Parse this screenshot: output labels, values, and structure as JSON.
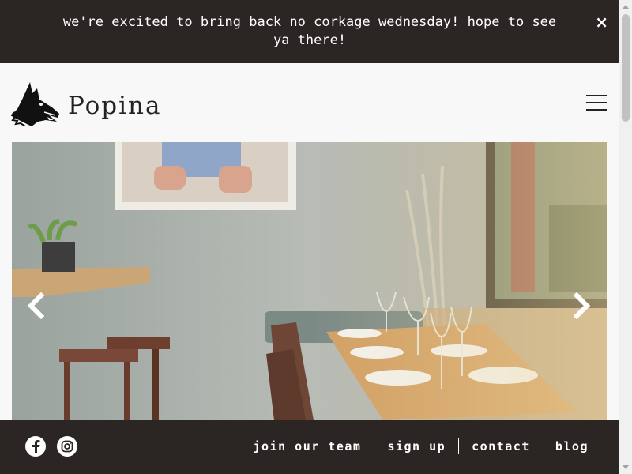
{
  "announcement": {
    "text": "we're excited to bring back no corkage wednesday! hope to see ya there!",
    "close_icon": "×"
  },
  "header": {
    "brand": "Popina",
    "logo_icon": "fox-head-logo",
    "menu_icon": "hamburger-menu-icon"
  },
  "hero": {
    "prev_icon": "chevron-left-icon",
    "next_icon": "chevron-right-icon"
  },
  "footer": {
    "social": [
      "facebook-icon",
      "instagram-icon"
    ],
    "links": [
      "join our team",
      "sign up",
      "contact",
      "blog"
    ]
  },
  "colors": {
    "dark": "#2b2523",
    "background": "#f8f8f8",
    "text": "#ffffff"
  }
}
